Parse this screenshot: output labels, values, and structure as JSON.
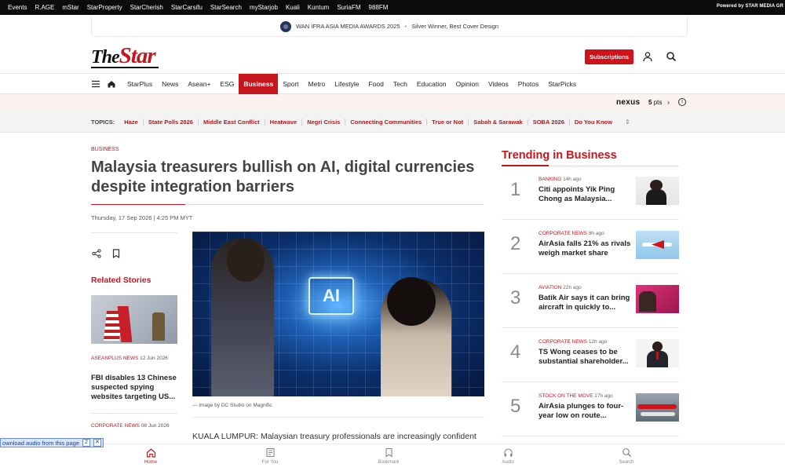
{
  "topbar": {
    "links": [
      "Events",
      "R.AGE",
      "mStar",
      "StarProperty",
      "StarCherish",
      "StarCarsifu",
      "StarSearch",
      "myStarjob",
      "Kuali",
      "Kuntum",
      "SuriaFM",
      "988FM"
    ],
    "powered": "Powered by STAR MEDIA GR"
  },
  "award": {
    "title": "WAN IFRA ASIA MEDIA AWARDS 2025",
    "subtitle": "Silver Winner, Best Cover Design"
  },
  "header": {
    "logo_the": "The",
    "logo_star": "Star",
    "subscribe_label": "Subscriptions"
  },
  "nav": {
    "items": [
      "StarPlus",
      "News",
      "Asean+",
      "ESG",
      "Business",
      "Sport",
      "Metro",
      "Lifestyle",
      "Food",
      "Tech",
      "Education",
      "Opinion",
      "Videos",
      "Photos",
      "StarPicks"
    ],
    "active": "Business"
  },
  "nexus": {
    "brand": "nexus",
    "points": "5",
    "points_unit": "pts"
  },
  "topics": {
    "label": "TOPICS:",
    "items": [
      "Haze",
      "State Polls 2026",
      "Middle East Conflict",
      "Heatwave",
      "Negri Crisis",
      "Connecting Communities",
      "True or Not",
      "Sabah & Sarawak",
      "SOBA 2026",
      "Do You Know"
    ]
  },
  "article": {
    "kicker": "BUSINESS",
    "headline": "Malaysia treasurers bullish on AI, digital currencies despite integration barriers",
    "dateline": "Thursday, 17 Sep 2026 | 4:25 PM MYT",
    "image_text": "AI",
    "caption": "— Image by DC Studio on Magnific",
    "body": "KUALA LUMPUR: Malaysian treasury professionals are increasingly confident"
  },
  "related": {
    "heading": "Related Stories",
    "items": [
      {
        "category": "ASEANPLUS NEWS",
        "date": "12 Jun 2026",
        "title": "FBI disables 13 Chinese suspected spying websites targeting US..."
      },
      {
        "category": "CORPORATE NEWS",
        "date": "08 Jun 2026",
        "title": ""
      }
    ]
  },
  "trending": {
    "heading": "Trending in Business",
    "items": [
      {
        "rank": "1",
        "category": "BANKING",
        "ago": "14h ago",
        "title": "Citi appoints Yik Ping Chong as Malaysia..."
      },
      {
        "rank": "2",
        "category": "CORPORATE NEWS",
        "ago": "8h ago",
        "title": "AirAsia falls 21% as rivals weigh market share"
      },
      {
        "rank": "3",
        "category": "AVIATION",
        "ago": "22h ago",
        "title": "Batik Air says it can bring aircraft in quickly to..."
      },
      {
        "rank": "4",
        "category": "CORPORATE NEWS",
        "ago": "12h ago",
        "title": "TS Wong ceases to be substantial shareholder..."
      },
      {
        "rank": "5",
        "category": "STOCK ON THE MOVE",
        "ago": "17h ago",
        "title": "AirAsia plunges to four-year low on route..."
      }
    ]
  },
  "bottom_nav": {
    "items": [
      "Home",
      "For You",
      "Bookmark",
      "Audio",
      "Search"
    ],
    "active": "Home"
  },
  "audio_widget": {
    "label": "ownload audio from this page",
    "ctrl1": "2",
    "ctrl2": "✕"
  },
  "colors": {
    "brand_red": "#c4161c",
    "topbar": "#0b0b0b",
    "topics_bg": "#f3f3f3"
  }
}
